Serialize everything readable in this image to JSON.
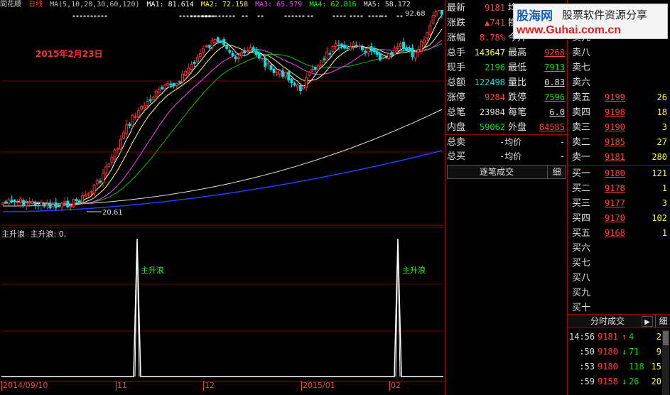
{
  "header": {
    "app_name": "同花顺",
    "period": "日线",
    "ma_params": "MA(5,10,20,30,60,120)",
    "ma1": "MA1: 81.614",
    "ma2": "MA2: 72.158",
    "ma3": "MA3: 65.579",
    "ma4": "MA4: 62.816",
    "ma5": "MA5: 58.172",
    "colors": {
      "ma1": "#ffffff",
      "ma2": "#ffff00",
      "ma3": "#ff00ff",
      "ma4": "#00ff00",
      "ma5": "#e0e0e0"
    }
  },
  "price_pane": {
    "annotation_date": "2015年2月23日",
    "high_label": "92.68",
    "low_label": "20.61"
  },
  "osc_pane": {
    "title": "主升浪",
    "value_label": "主升浪: 0,",
    "signal_label_1": "主升浪",
    "signal_label_2": "主升浪"
  },
  "x_axis": {
    "labels": [
      "2014/09/10",
      "11",
      "12",
      "2015/01",
      "02"
    ]
  },
  "quote": {
    "rows": [
      {
        "label": "最新",
        "value": "9181",
        "color": "red",
        "extra_label": "均",
        "extra_value": ""
      },
      {
        "label": "涨跌",
        "value": "▲741",
        "color": "red",
        "extra_label": "换手",
        "extra_value": ""
      },
      {
        "label": "涨幅",
        "value": "8.78%",
        "color": "red",
        "extra_label": "今开",
        "extra_value": ""
      },
      {
        "label": "总手",
        "value": "143647",
        "color": "yellow",
        "extra_label": "最高",
        "extra_value": "9268"
      },
      {
        "label": "现手",
        "value": "2196",
        "color": "green",
        "extra_label": "最低",
        "extra_value": "7913"
      },
      {
        "label": "总额",
        "value": "122498",
        "color": "cyan",
        "extra_label": "量比",
        "extra_value": "0.83"
      },
      {
        "label": "涨停",
        "value": "9284",
        "color": "red",
        "extra_label": "跌停",
        "extra_value": "7596"
      },
      {
        "label": "总笔",
        "value": "23984",
        "color": "white",
        "extra_label": "每笔",
        "extra_value": "6.0"
      },
      {
        "label": "内盘",
        "value": "59062",
        "color": "green",
        "extra_label": "外盘",
        "extra_value": "84585"
      }
    ],
    "extra_colors": [
      "red",
      "red",
      "red",
      "red",
      "green",
      "white",
      "green",
      "white",
      "red"
    ],
    "total_sell_label": "总卖",
    "total_sell_avg": "-均价",
    "total_sell_value": "-",
    "total_buy_label": "总买",
    "total_buy_avg": "-均价",
    "total_buy_value": "-",
    "tick_button": "逐笔成交",
    "detail_button": "细"
  },
  "book": {
    "asks": [
      {
        "label": "卖九",
        "price": "",
        "vol": ""
      },
      {
        "label": "卖八",
        "price": "",
        "vol": ""
      },
      {
        "label": "卖七",
        "price": "",
        "vol": ""
      },
      {
        "label": "卖六",
        "price": "",
        "vol": ""
      },
      {
        "label": "卖五",
        "price": "9199",
        "vol": "26"
      },
      {
        "label": "卖四",
        "price": "9198",
        "vol": "18"
      },
      {
        "label": "卖三",
        "price": "9190",
        "vol": "3"
      },
      {
        "label": "卖二",
        "price": "9185",
        "vol": "27"
      },
      {
        "label": "卖一",
        "price": "9181",
        "vol": "280"
      }
    ],
    "bids": [
      {
        "label": "买一",
        "price": "9180",
        "vol": "121"
      },
      {
        "label": "买二",
        "price": "9178",
        "vol": "1"
      },
      {
        "label": "买三",
        "price": "9177",
        "vol": "3"
      },
      {
        "label": "买四",
        "price": "9170",
        "vol": "102"
      },
      {
        "label": "买五",
        "price": "9168",
        "vol": "1"
      },
      {
        "label": "买六",
        "price": "",
        "vol": ""
      },
      {
        "label": "买七",
        "price": "",
        "vol": ""
      },
      {
        "label": "买八",
        "price": "",
        "vol": ""
      },
      {
        "label": "买九",
        "price": "",
        "vol": ""
      },
      {
        "label": "买十",
        "price": "",
        "vol": ""
      }
    ],
    "trade_button": "分时成交",
    "play_icon": "▶",
    "detail_button": "细"
  },
  "trades": [
    {
      "time": "14:56",
      "price": "9181",
      "arrow": "↑",
      "vol": "4",
      "n": "2"
    },
    {
      "time": ":50",
      "price": "9180",
      "arrow": "↓",
      "vol": "71",
      "n": "9"
    },
    {
      "time": ":53",
      "price": "9180",
      "arrow": "",
      "vol": "118",
      "n": "15"
    },
    {
      "time": ":59",
      "price": "9158",
      "arrow": "↓",
      "vol": "26",
      "n": "20"
    }
  ],
  "logo": {
    "name": "股海网",
    "tagline": "股票软件资源分享",
    "url": "www.Guhai.com.cn"
  }
}
